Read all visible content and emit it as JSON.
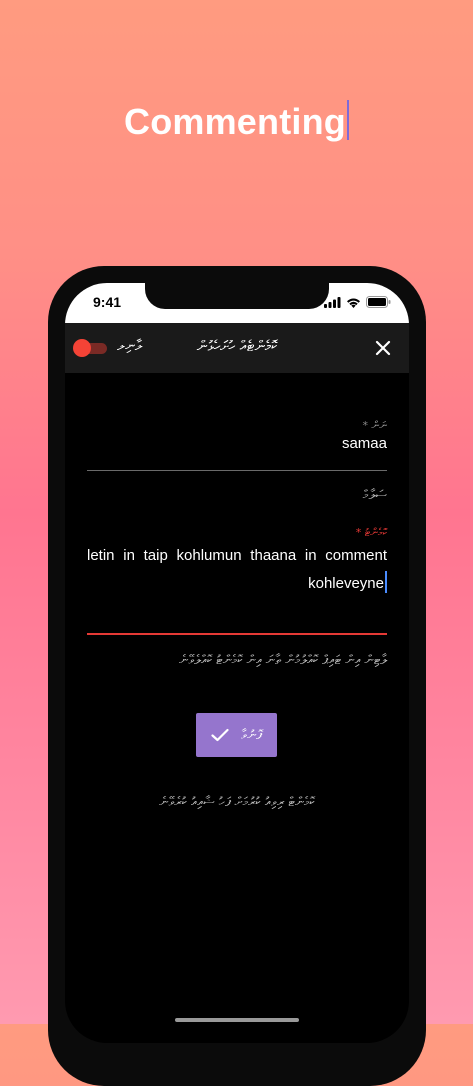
{
  "headline": "Commenting",
  "status_bar": {
    "time": "9:41"
  },
  "app_bar": {
    "toggle_label": "ލާނިލ",
    "title": "ކޮމެންޓެއް ހުށަހެޅުން",
    "close_icon": "close-icon"
  },
  "form": {
    "name_label": "ނަން",
    "name_required_marker": "*",
    "name_value": "samaa",
    "hint_text": "ސަލާމް",
    "comment_label": "ކޮމެންޓު",
    "comment_required_marker": "*",
    "comment_value": "letin in taip kohlumun thaana in comment kohleveyne",
    "error_text": "ލާޓިން އިން ޓައިޕް ކޮއްލުމުން ތާނަ އިން ކޮމެންޓު ކޮއްލެވޭނެ",
    "submit_label": "ފޮނުވާ",
    "footer_note": "ކޮމެންޓް ރިވިއު ކުރުމަށް ފަހު ޝާއިއު ކުރެވޭނެ"
  },
  "colors": {
    "accent": "#9575cd",
    "error": "#e53935",
    "toggle": "#f44336",
    "caret": "#4a8cff"
  }
}
